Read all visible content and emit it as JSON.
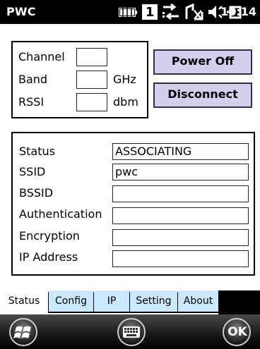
{
  "titlebar": {
    "title": "PWC",
    "clock": "10:14",
    "notification_count": "1",
    "icons": [
      "battery-icon",
      "notification-icon",
      "connectivity-icon",
      "signal-icon",
      "volume-icon",
      "sync-icon"
    ]
  },
  "radio": {
    "channel_label": "Channel",
    "channel_value": "",
    "band_label": "Band",
    "band_value": "",
    "band_unit": "GHz",
    "rssi_label": "RSSI",
    "rssi_value": "",
    "rssi_unit": "dbm"
  },
  "buttons": {
    "power_off": "Power Off",
    "disconnect": "Disconnect"
  },
  "status": {
    "fields": [
      {
        "label": "Status",
        "value": "ASSOCIATING"
      },
      {
        "label": "SSID",
        "value": "pwc"
      },
      {
        "label": "BSSID",
        "value": ""
      },
      {
        "label": "Authentication",
        "value": ""
      },
      {
        "label": "Encryption",
        "value": ""
      },
      {
        "label": "IP Address",
        "value": ""
      }
    ]
  },
  "tabs": [
    {
      "label": "Status",
      "active": true
    },
    {
      "label": "Config",
      "active": false
    },
    {
      "label": "IP",
      "active": false
    },
    {
      "label": "Setting",
      "active": false
    },
    {
      "label": "About",
      "active": false
    }
  ],
  "softkeys": {
    "start_icon": "windows-start-icon",
    "keyboard_icon": "keyboard-icon",
    "ok_label": "OK"
  },
  "colors": {
    "button_fill": "#d3d0ef",
    "tab_fill": "#cce8ff",
    "titlebar": "#000000"
  }
}
